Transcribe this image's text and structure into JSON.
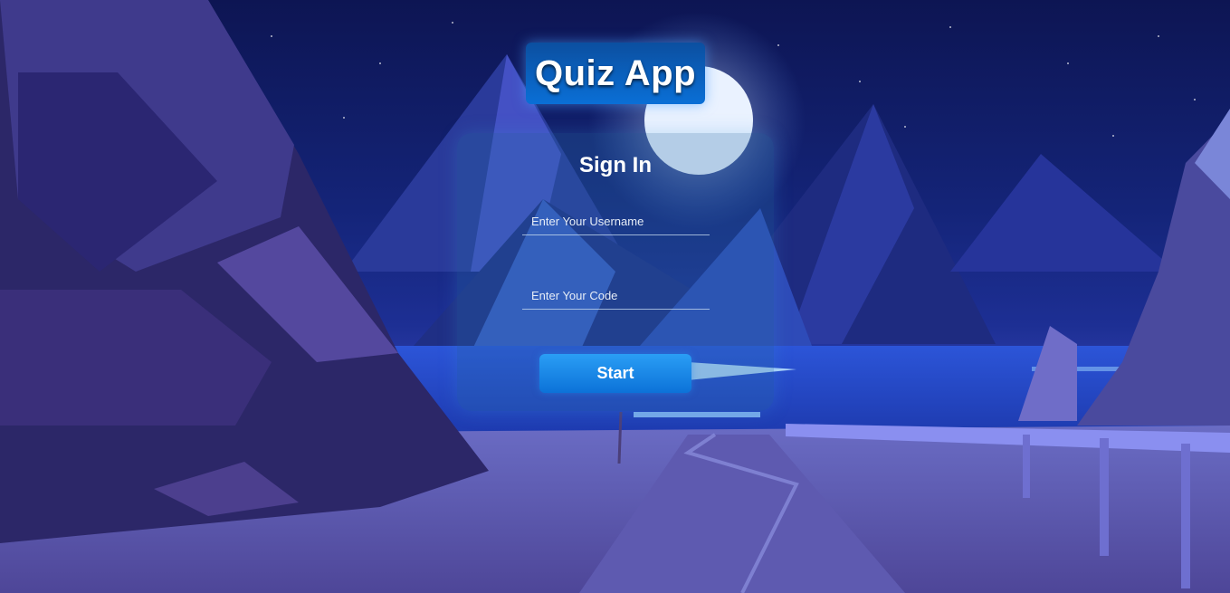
{
  "app": {
    "title": "Quiz App"
  },
  "signin": {
    "heading": "Sign In",
    "username_placeholder": "Enter Your Username",
    "username_value": "",
    "code_placeholder": "Enter Your Code",
    "code_value": "",
    "start_label": "Start"
  },
  "colors": {
    "accent": "#0c72d8",
    "title_bg": "#0a6fd6",
    "sky_top": "#0d1553",
    "moon": "#eaf2ff"
  },
  "background": {
    "description_icon": "night-mountain-landscape"
  }
}
